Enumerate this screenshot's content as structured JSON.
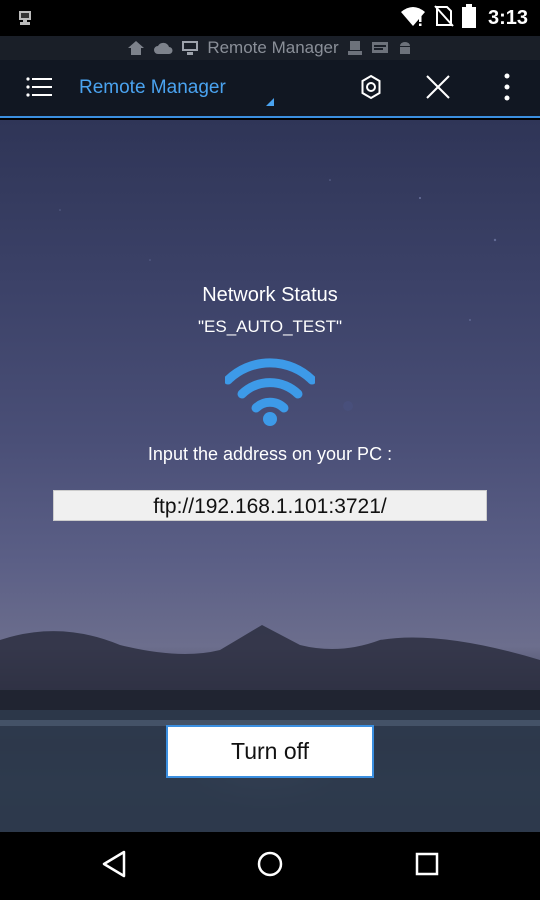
{
  "status_bar": {
    "time": "3:13",
    "icons": [
      "remote-manager-notification-icon",
      "wifi-signal-icon",
      "no-sim-icon",
      "battery-icon"
    ]
  },
  "window_strip": {
    "title": "Remote Manager",
    "icons": [
      "home-icon",
      "cloud-icon",
      "remote-manager-icon",
      "user-icon",
      "message-icon",
      "android-icon"
    ]
  },
  "toolbar": {
    "title": "Remote Manager",
    "icons": [
      "menu-icon",
      "settings-icon",
      "close-icon",
      "more-icon"
    ]
  },
  "main": {
    "network_title": "Network Status",
    "ssid": "\"ES_AUTO_TEST\"",
    "instruction": "Input the address on your PC :",
    "address": "ftp://192.168.1.101:3721/",
    "turn_off_label": "Turn off"
  },
  "nav_bar": {
    "icons": [
      "back-icon",
      "home-circle-icon",
      "recents-icon"
    ]
  },
  "colors": {
    "accent": "#3b8fe0",
    "title_blue": "#4aa3f0",
    "wifi_blue": "#3d9ae8"
  }
}
